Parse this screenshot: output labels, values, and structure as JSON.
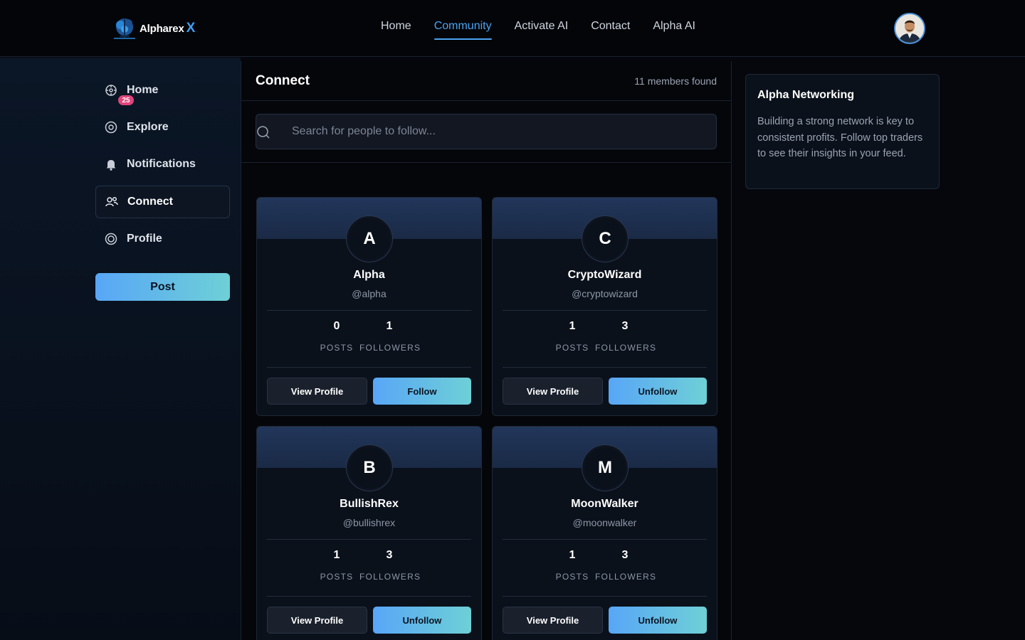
{
  "brand": {
    "name": "Alpharex",
    "suffix": "X"
  },
  "nav": {
    "items": [
      {
        "label": "Home",
        "active": false
      },
      {
        "label": "Community",
        "active": true
      },
      {
        "label": "Activate AI",
        "active": false
      },
      {
        "label": "Contact",
        "active": false
      },
      {
        "label": "Alpha AI",
        "active": false
      }
    ]
  },
  "sidebar": {
    "items": [
      {
        "label": "Home",
        "icon": "home-icon"
      },
      {
        "label": "Explore",
        "icon": "compass-icon"
      },
      {
        "label": "Notifications",
        "icon": "bell-icon",
        "badge": "25"
      },
      {
        "label": "Connect",
        "icon": "users-icon",
        "active": true
      },
      {
        "label": "Profile",
        "icon": "profile-icon"
      }
    ],
    "post_label": "Post"
  },
  "connect": {
    "title": "Connect",
    "members_found": "11 members found",
    "search_placeholder": "Search for people to follow...",
    "stat_labels": {
      "posts": "POSTS",
      "followers": "FOLLOWERS"
    },
    "view_profile_label": "View Profile",
    "cards": [
      {
        "initial": "A",
        "name": "Alpha",
        "handle": "@alpha",
        "posts": "0",
        "followers": "1",
        "action": "Follow"
      },
      {
        "initial": "C",
        "name": "CryptoWizard",
        "handle": "@cryptowizard",
        "posts": "1",
        "followers": "3",
        "action": "Unfollow"
      },
      {
        "initial": "B",
        "name": "BullishRex",
        "handle": "@bullishrex",
        "posts": "1",
        "followers": "3",
        "action": "Unfollow"
      },
      {
        "initial": "M",
        "name": "MoonWalker",
        "handle": "@moonwalker",
        "posts": "1",
        "followers": "3",
        "action": "Unfollow"
      }
    ]
  },
  "info": {
    "title": "Alpha Networking",
    "text": "Building a strong network is key to consistent profits. Follow top traders to see their insights in your feed."
  },
  "colors": {
    "accent": "#4aa3f0",
    "badge": "#e0457b",
    "gradient_start": "#58a6f7",
    "gradient_end": "#6ed0d6"
  }
}
